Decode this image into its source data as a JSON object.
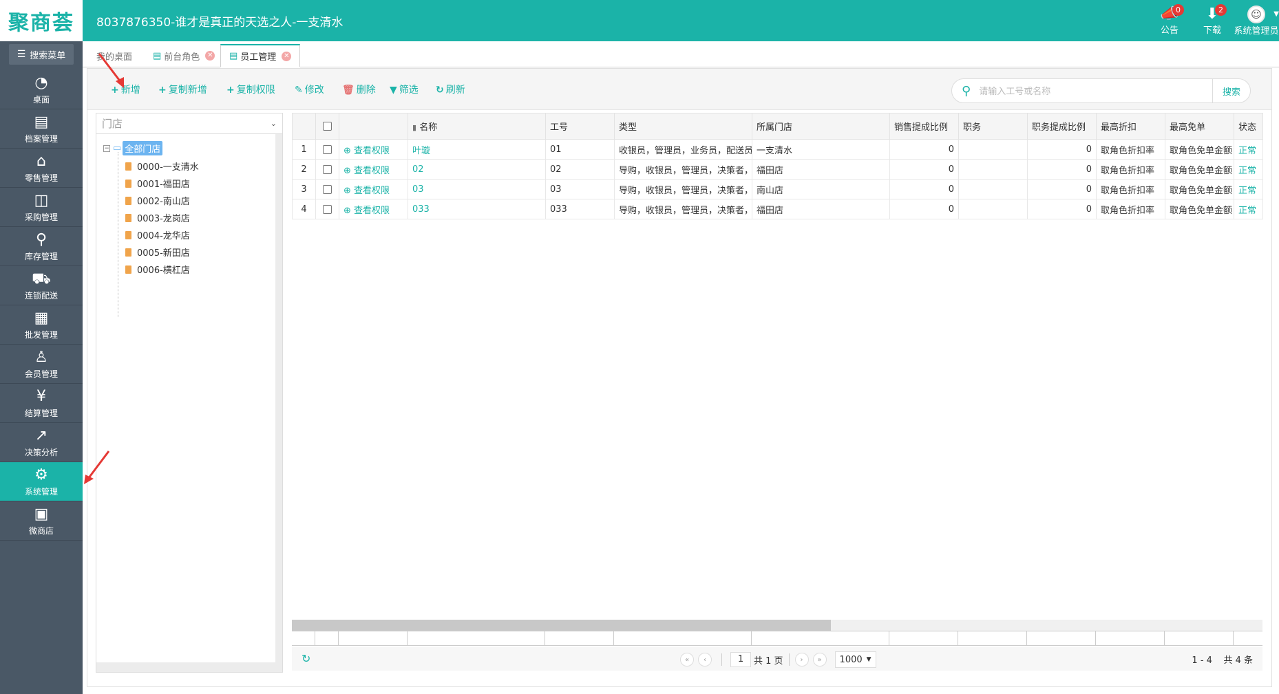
{
  "header": {
    "logo": "聚商荟",
    "title": "8037876350-谁才是真正的天选之人-一支清水",
    "notice": {
      "label": "公告",
      "count": "0"
    },
    "download": {
      "label": "下载",
      "count": "2"
    },
    "user": {
      "label": "系统管理员"
    }
  },
  "sidebar": {
    "search_menu": "搜索菜单",
    "items": [
      {
        "label": "桌面",
        "icon": "dashboard-icon"
      },
      {
        "label": "档案管理",
        "icon": "archive-icon"
      },
      {
        "label": "零售管理",
        "icon": "store-icon"
      },
      {
        "label": "采购管理",
        "icon": "cart-icon"
      },
      {
        "label": "库存管理",
        "icon": "inventory-icon"
      },
      {
        "label": "连锁配送",
        "icon": "truck-icon"
      },
      {
        "label": "批发管理",
        "icon": "wholesale-icon"
      },
      {
        "label": "会员管理",
        "icon": "member-icon"
      },
      {
        "label": "结算管理",
        "icon": "settlement-icon"
      },
      {
        "label": "决策分析",
        "icon": "analytics-icon"
      },
      {
        "label": "系统管理",
        "icon": "gear-icon"
      },
      {
        "label": "微商店",
        "icon": "shop-bag-icon"
      }
    ],
    "active": "系统管理"
  },
  "tabs": [
    {
      "label": "我的桌面"
    },
    {
      "label": "前台角色"
    },
    {
      "label": "员工管理"
    }
  ],
  "toolbar": {
    "add": "新增",
    "copy_add": "复制新增",
    "copy_perm": "复制权限",
    "edit": "修改",
    "delete": "删除",
    "filter": "筛选",
    "refresh": "刷新",
    "search_placeholder": "请输入工号或名称",
    "search_button": "搜索"
  },
  "tree": {
    "select_label": "门店",
    "root": "全部门店",
    "nodes": [
      "0000-一支清水",
      "0001-福田店",
      "0002-南山店",
      "0003-龙岗店",
      "0004-龙华店",
      "0005-新田店",
      "0006-横杠店"
    ]
  },
  "grid": {
    "columns": [
      "名称",
      "工号",
      "类型",
      "所属门店",
      "销售提成比例",
      "职务",
      "职务提成比例",
      "最高折扣",
      "最高免单",
      "状态"
    ],
    "perm_label": "查看权限",
    "rows": [
      {
        "no": "1",
        "name": "叶璇",
        "code": "01",
        "type": "收银员，管理员，业务员，配送员",
        "store": "一支清水",
        "sales_rate": "0",
        "position": "",
        "position_rate": "0",
        "max_discount": "取角色折扣率",
        "max_free": "取角色免单金额",
        "status": "正常"
      },
      {
        "no": "2",
        "name": "02",
        "code": "02",
        "type": "导购，收银员，管理员，决策者，",
        "store": "福田店",
        "sales_rate": "0",
        "position": "",
        "position_rate": "0",
        "max_discount": "取角色折扣率",
        "max_free": "取角色免单金额",
        "status": "正常"
      },
      {
        "no": "3",
        "name": "03",
        "code": "03",
        "type": "导购，收银员，管理员，决策者，",
        "store": "南山店",
        "sales_rate": "0",
        "position": "",
        "position_rate": "0",
        "max_discount": "取角色折扣率",
        "max_free": "取角色免单金额",
        "status": "正常"
      },
      {
        "no": "4",
        "name": "033",
        "code": "033",
        "type": "导购，收银员，管理员，决策者，",
        "store": "福田店",
        "sales_rate": "0",
        "position": "",
        "position_rate": "0",
        "max_discount": "取角色折扣率",
        "max_free": "取角色免单金额",
        "status": "正常"
      }
    ]
  },
  "pager": {
    "page": "1",
    "total_pages": "共 1 页",
    "page_size": "1000",
    "range": "1 - 4",
    "total": "共 4 条"
  },
  "colors": {
    "accent": "#1bb3a8",
    "sidebar": "#4a5866",
    "badge": "#e53935"
  }
}
